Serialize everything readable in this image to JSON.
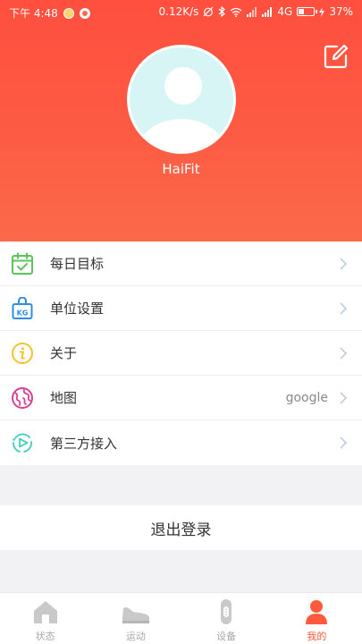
{
  "status_bar": {
    "time": "下午 4:48",
    "net_speed": "0.12K/s",
    "network": "4G",
    "battery_percent": "37%",
    "battery_level": 0.37
  },
  "profile": {
    "username": "HaiFit"
  },
  "menu": {
    "items": [
      {
        "label": "每日目标",
        "value": "",
        "icon": "calendar-check-icon"
      },
      {
        "label": "单位设置",
        "value": "",
        "icon": "kg-weight-icon"
      },
      {
        "label": "关于",
        "value": "",
        "icon": "info-icon"
      },
      {
        "label": "地图",
        "value": "google",
        "icon": "globe-icon"
      },
      {
        "label": "第三方接入",
        "value": "",
        "icon": "third-party-icon"
      }
    ]
  },
  "logout": {
    "label": "退出登录"
  },
  "bottom_nav": {
    "tabs": [
      {
        "label": "状态",
        "icon": "home-icon",
        "active": false
      },
      {
        "label": "运动",
        "icon": "shoe-icon",
        "active": false
      },
      {
        "label": "设备",
        "icon": "band-icon",
        "active": false
      },
      {
        "label": "我的",
        "icon": "person-icon",
        "active": true
      }
    ]
  },
  "colors": {
    "header": "#fd5b43",
    "accent": "#ff5a3c",
    "inactive": "#a8a8a8"
  }
}
